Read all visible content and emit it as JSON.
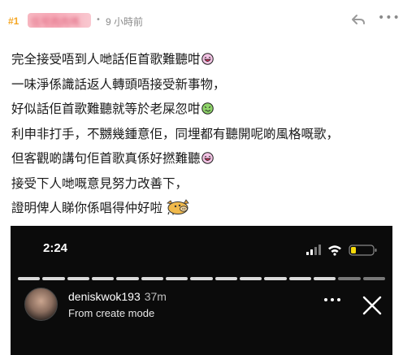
{
  "header": {
    "floor": "#1",
    "username": "伍号肉肉嗎",
    "separator": "•",
    "timestamp": "9 小時前"
  },
  "post": {
    "lines": [
      {
        "text": "完全接受唔到人哋話佢首歌難聽咁",
        "emoji": "laughing-face-icon"
      },
      {
        "text": "一味淨係識話返人轉頭唔接受新事物，",
        "emoji": null
      },
      {
        "text": "好似話佢首歌難聽就等於老屎忽咁",
        "emoji": "sick-face-icon"
      },
      {
        "text": "利申非打手，不嬲幾鍾意佢，同埋都有聽開呢啲風格嘅歌，",
        "emoji": null
      },
      {
        "text": "但客觀啲講句佢首歌真係好撚難聽",
        "emoji": "laughing-face-icon"
      },
      {
        "text": "接受下人哋嘅意見努力改善下，",
        "emoji": null
      },
      {
        "text": "證明俾人睇你係唱得仲好啦",
        "emoji": "pig-face-icon"
      }
    ]
  },
  "story": {
    "status_time": "2:24",
    "username": "deniskwok193",
    "age": "37m",
    "subtitle": "From create mode",
    "segments_total": 15,
    "segments_done": 13
  },
  "colors": {
    "floor": "#f5a623",
    "story_bg": "#0b0b0b",
    "battery": "#f5d90a"
  }
}
